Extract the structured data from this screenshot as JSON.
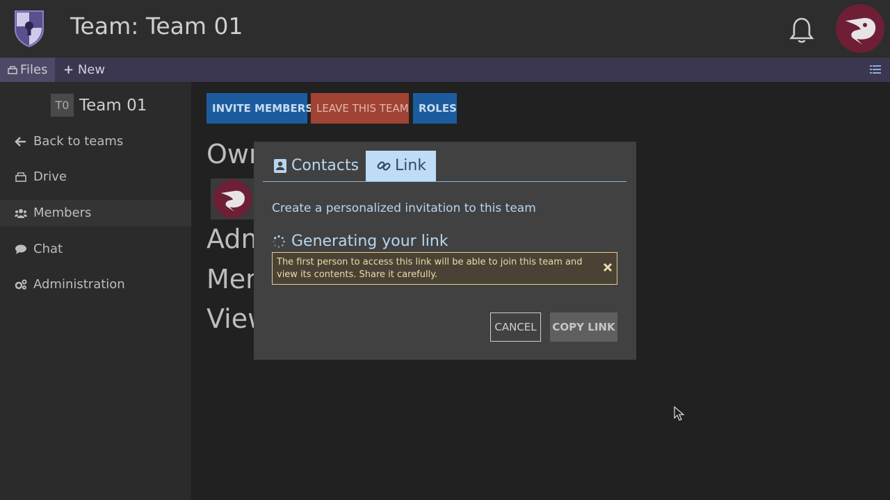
{
  "header": {
    "title": "Team: Team 01",
    "logo_icon": "shield-keyhole-logo",
    "notifications_icon": "bell-icon"
  },
  "toolbar": {
    "files_label": "Files",
    "new_label": "New",
    "files_icon": "drive-icon",
    "new_icon": "plus-icon",
    "list_icon": "list-icon"
  },
  "sidebar": {
    "team_badge": "T0",
    "team_name": "Team 01",
    "items": [
      {
        "label": "Back to teams",
        "icon": "arrow-left-icon"
      },
      {
        "label": "Drive",
        "icon": "drive-icon"
      },
      {
        "label": "Members",
        "icon": "users-icon",
        "active": true
      },
      {
        "label": "Chat",
        "icon": "chat-icon"
      },
      {
        "label": "Administration",
        "icon": "gears-icon"
      }
    ]
  },
  "main": {
    "buttons": {
      "invite": "INVITE MEMBERS",
      "leave": "LEAVE THIS TEAM",
      "roles": "ROLES"
    },
    "sections": [
      "Own",
      "Adm",
      "Mem",
      "View"
    ]
  },
  "modal": {
    "tabs": [
      {
        "label": "Contacts",
        "icon": "address-book-icon"
      },
      {
        "label": "Link",
        "icon": "link-icon",
        "selected": true
      }
    ],
    "description": "Create a personalized invitation to this team",
    "status": "Generating your link",
    "warning": "The first person to access this link will be able to join this team and view its contents. Share it carefully.",
    "cancel_label": "CANCEL",
    "copy_label": "COPY LINK"
  },
  "colors": {
    "primary_button": "#1c5c9e",
    "danger_button": "#a04334",
    "toolbar": "#3b3751",
    "avatar": "#6e1f36",
    "warning_border": "#e6cf8b"
  }
}
